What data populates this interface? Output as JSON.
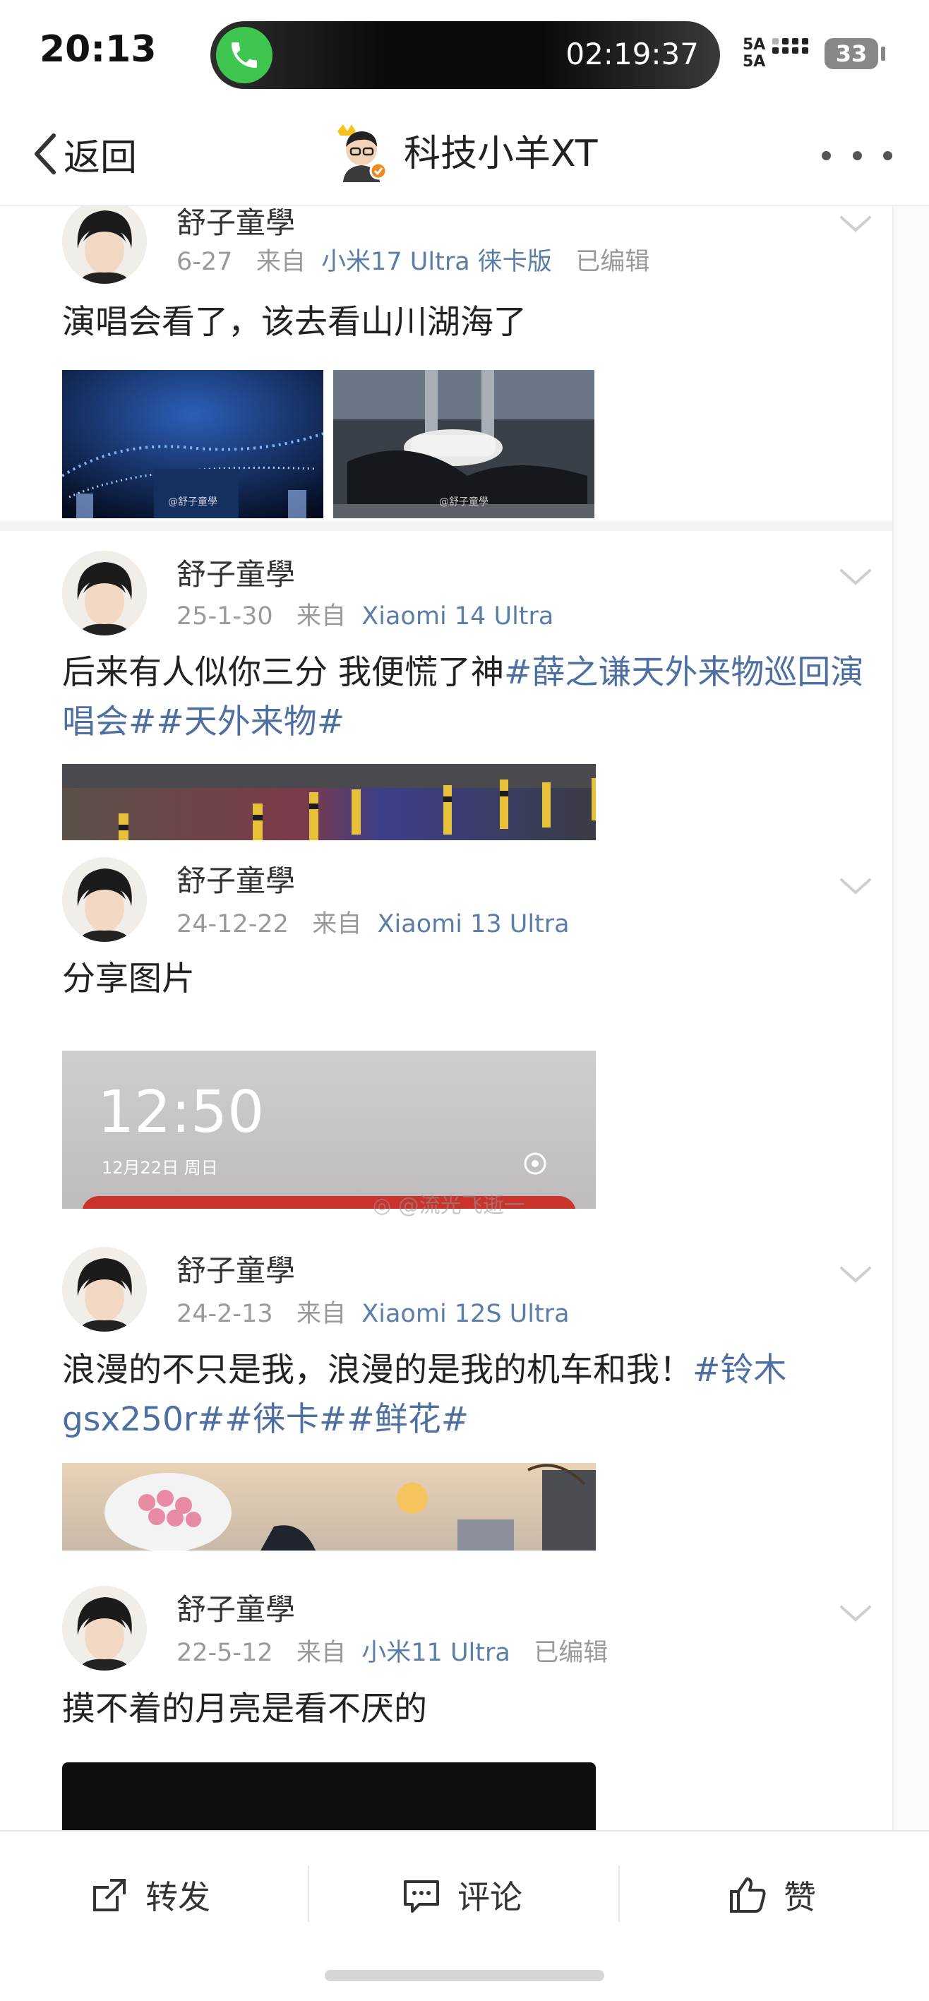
{
  "status_bar": {
    "time": "20:13",
    "call_timer": "02:19:37",
    "network_label": "5A\n5A",
    "battery": "33"
  },
  "nav": {
    "back_label": "返回",
    "title": "科技小羊XT"
  },
  "watermark": "@流光飞逝一",
  "posts": [
    {
      "user": "舒子童學",
      "date": "6-27",
      "via": "来自",
      "device": "小米17 Ultra 徕卡版",
      "edited": "已编辑",
      "text": "演唱会看了，该去看山川湖海了",
      "image_watermarks": [
        "@舒子童學",
        "@舒子童學"
      ]
    },
    {
      "user": "舒子童學",
      "date": "25-1-30",
      "via": "来自",
      "device": "Xiaomi 14 Ultra",
      "edited": "",
      "text": "后来有人似你三分 我便慌了神",
      "tags": "#薛之谦天外来物巡回演唱会##天外来物#"
    },
    {
      "user": "舒子童學",
      "date": "24-12-22",
      "via": "来自",
      "device": "Xiaomi 13 Ultra",
      "edited": "",
      "text": "分享图片",
      "lock_time": "12:50",
      "lock_date": "12月22日 周日"
    },
    {
      "user": "舒子童學",
      "date": "24-2-13",
      "via": "来自",
      "device": "Xiaomi 12S Ultra",
      "edited": "",
      "text": "浪漫的不只是我，浪漫的是我的机车和我！",
      "tags": "#铃木gsx250r##徕卡##鲜花#"
    },
    {
      "user": "舒子童學",
      "date": "22-5-12",
      "via": "来自",
      "device": "小米11 Ultra",
      "edited": "已编辑",
      "text": "摸不着的月亮是看不厌的"
    }
  ],
  "actions": {
    "repost": "转发",
    "comment": "评论",
    "like": "赞"
  },
  "colors": {
    "link": "#4e6fa1",
    "meta": "#9a9a9a",
    "call_green": "#3fc651"
  }
}
